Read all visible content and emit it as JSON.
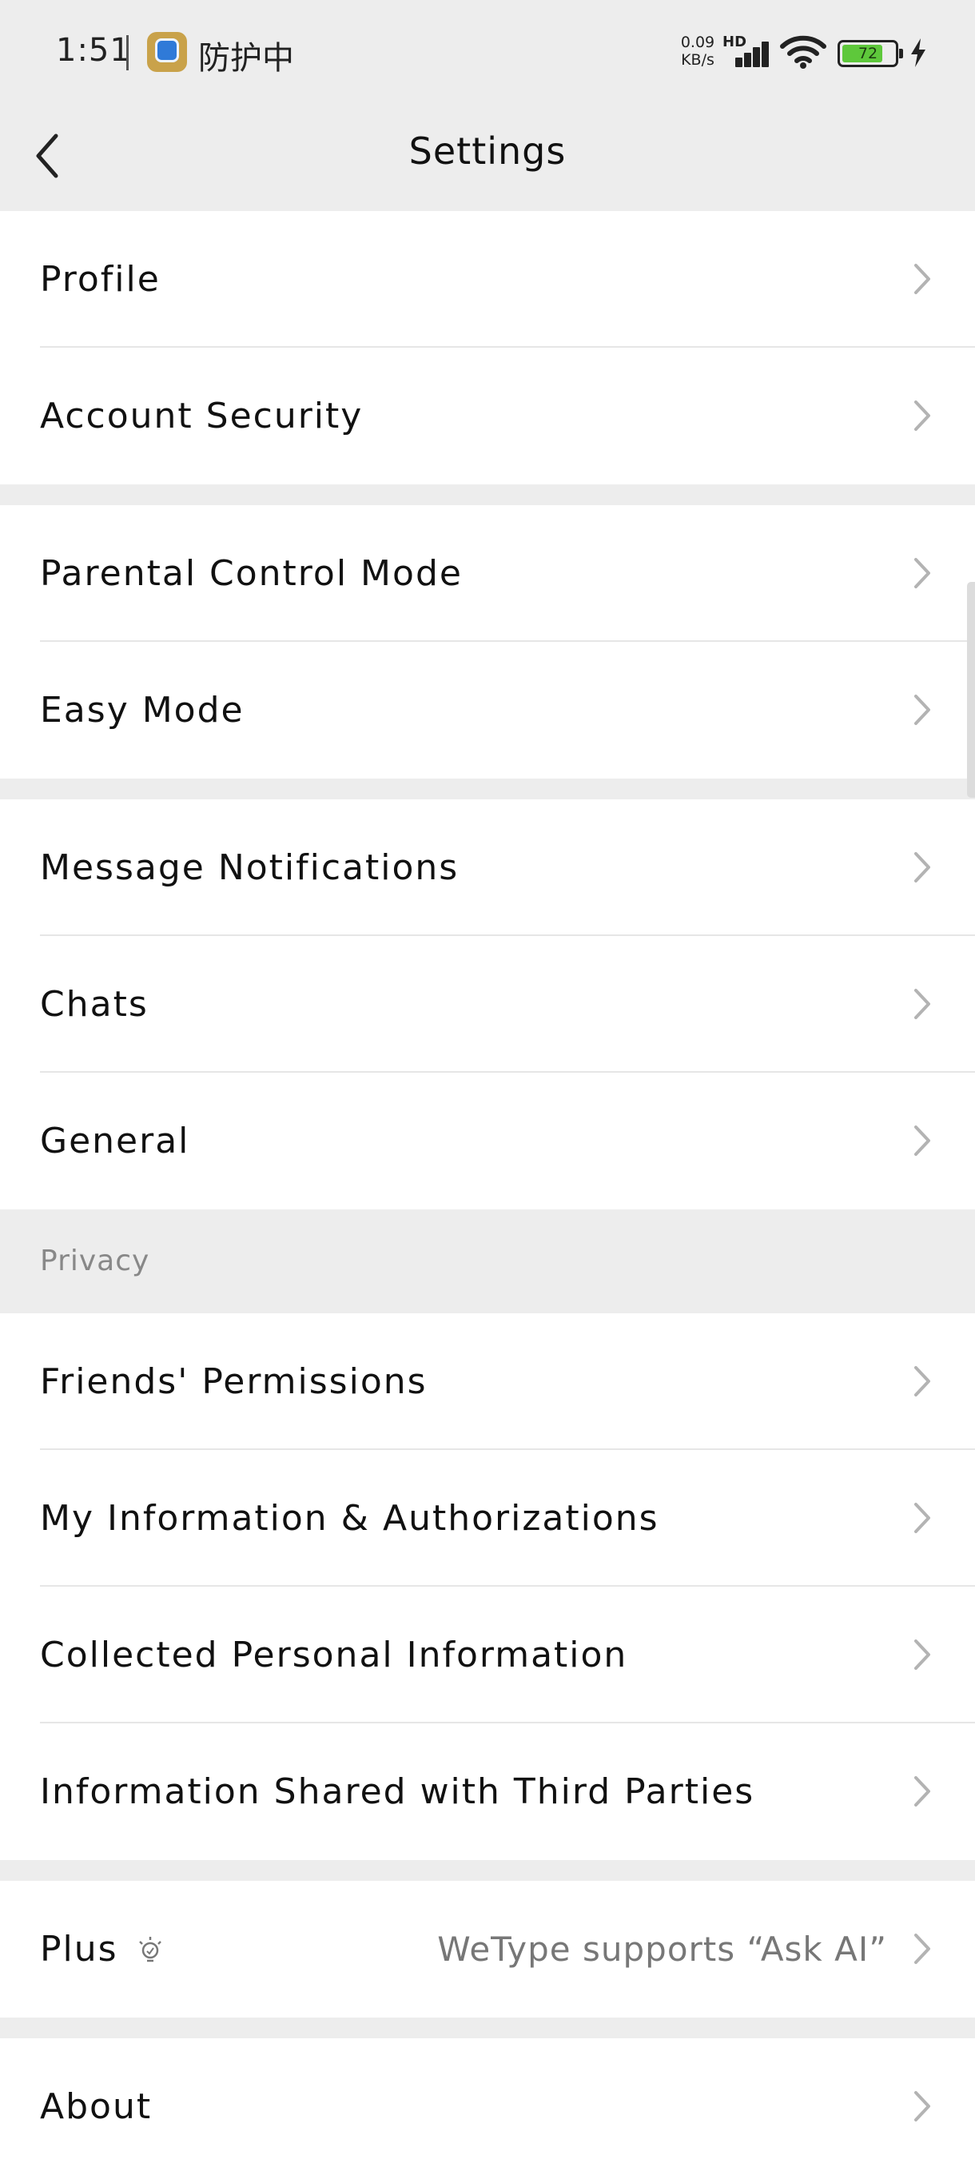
{
  "status_bar": {
    "time": "1:51",
    "app_text": "防护中",
    "speed_value": "0.09",
    "speed_unit": "KB/s",
    "hd_label": "HD",
    "battery_percent": "72"
  },
  "nav": {
    "title": "Settings"
  },
  "groups": {
    "account": [
      "Profile",
      "Account Security"
    ],
    "modes": [
      "Parental Control Mode",
      "Easy Mode"
    ],
    "general": [
      "Message Notifications",
      "Chats",
      "General"
    ],
    "privacy_header": "Privacy",
    "privacy": [
      "Friends' Permissions",
      "My Information & Authorizations",
      "Collected Personal Information",
      "Information Shared with Third Parties"
    ],
    "plus": {
      "label": "Plus",
      "value": "WeType supports “Ask AI”"
    },
    "about": "About"
  },
  "colors": {
    "background": "#ededed",
    "row_background": "#ffffff",
    "battery_fill": "#5ec83b"
  },
  "icons": {
    "back": "chevron-left-icon",
    "row_arrow": "chevron-right-icon",
    "plus_badge": "bulb-icon",
    "status_app": "shield-app-icon"
  }
}
